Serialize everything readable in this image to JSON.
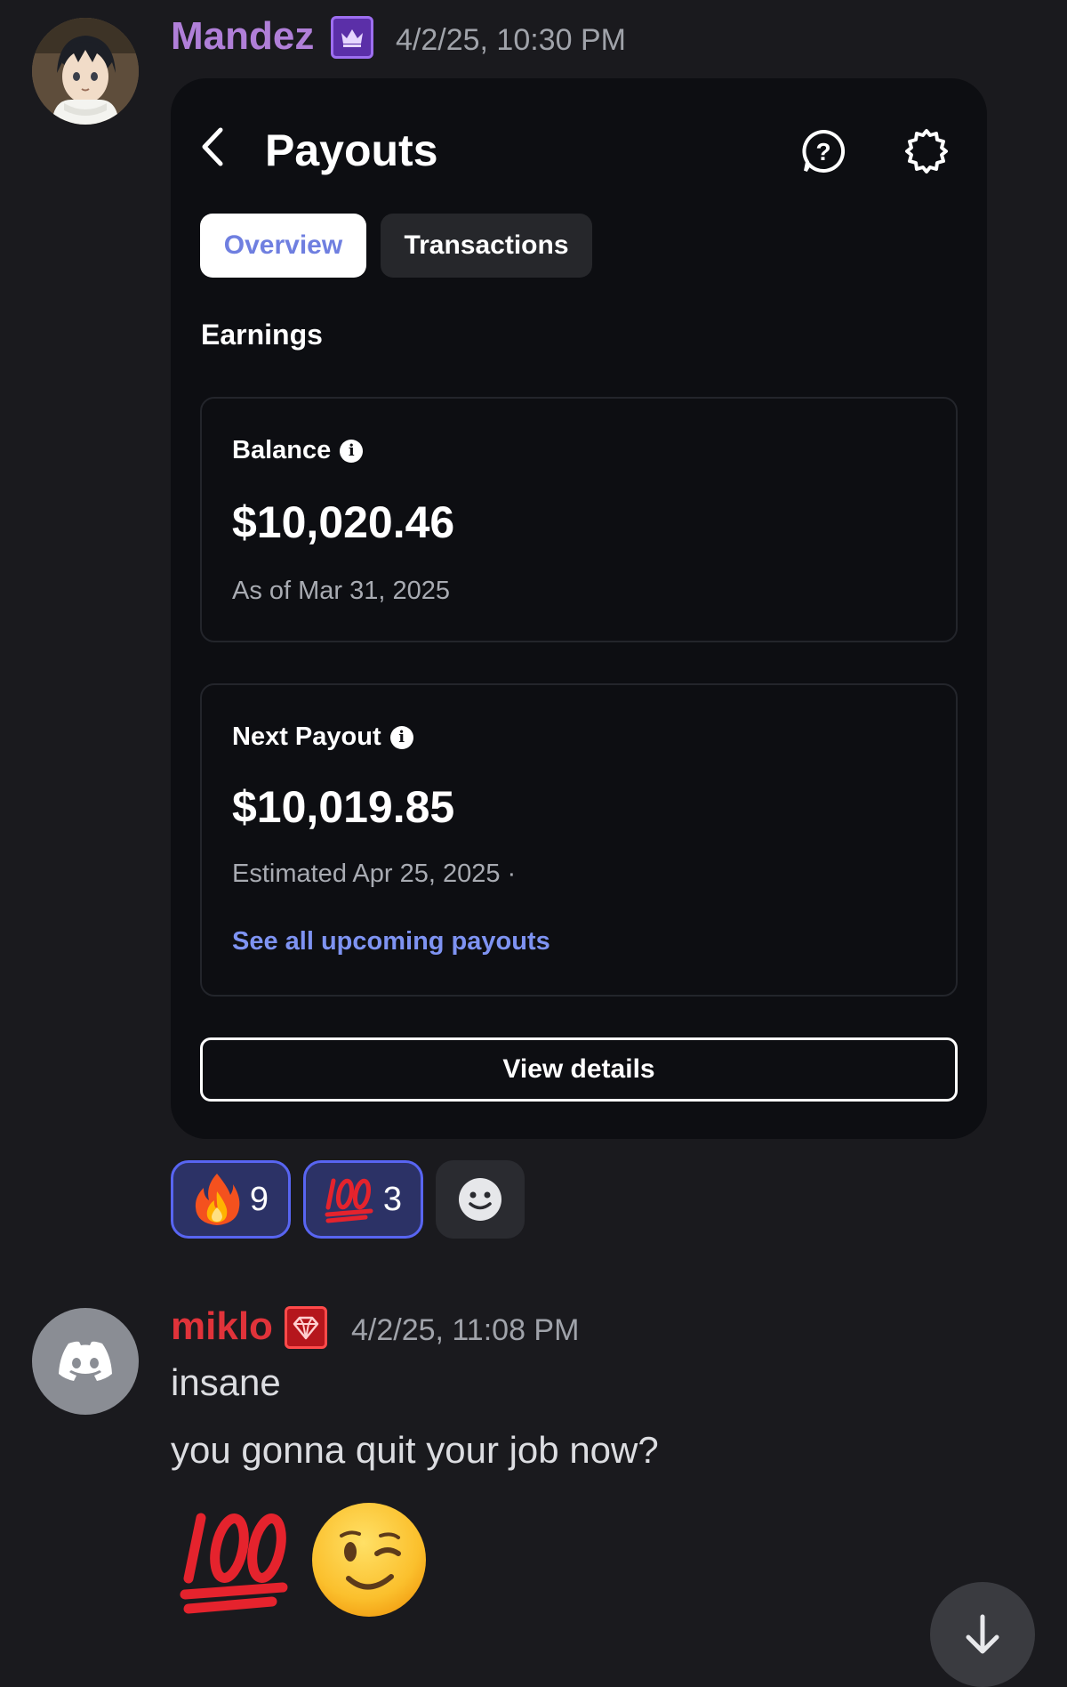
{
  "messages": [
    {
      "username": "Mandez",
      "timestamp": "4/2/25, 10:30 PM",
      "badge_icon": "crown-icon",
      "user_color": "#b07fd8"
    },
    {
      "username": "miklo",
      "timestamp": "4/2/25, 11:08 PM",
      "badge_icon": "gem-icon",
      "user_color": "#e0333a",
      "lines": [
        "insane",
        "you gonna quit your job now?"
      ],
      "emojis": [
        "hundred-points-emoji",
        "winking-face-emoji"
      ]
    }
  ],
  "payout_card": {
    "title": "Payouts",
    "tabs": [
      {
        "label": "Overview",
        "selected": true
      },
      {
        "label": "Transactions",
        "selected": false
      }
    ],
    "section_heading": "Earnings",
    "balance": {
      "label": "Balance",
      "amount": "$10,020.46",
      "sub": "As of Mar 31, 2025"
    },
    "next_payout": {
      "label": "Next Payout",
      "amount": "$10,019.85",
      "sub": "Estimated Apr 25, 2025 ·",
      "link": "See all upcoming payouts"
    },
    "view_details_label": "View details",
    "accent_color": "#7e93f2"
  },
  "reactions": [
    {
      "emoji": "fire-emoji",
      "count": "9",
      "active": true
    },
    {
      "emoji": "hundred-points-emoji",
      "count": "3",
      "active": true
    },
    {
      "emoji": "add-reaction-icon",
      "count": null,
      "active": false
    }
  ],
  "scroll_button_icon": "arrow-down-icon"
}
